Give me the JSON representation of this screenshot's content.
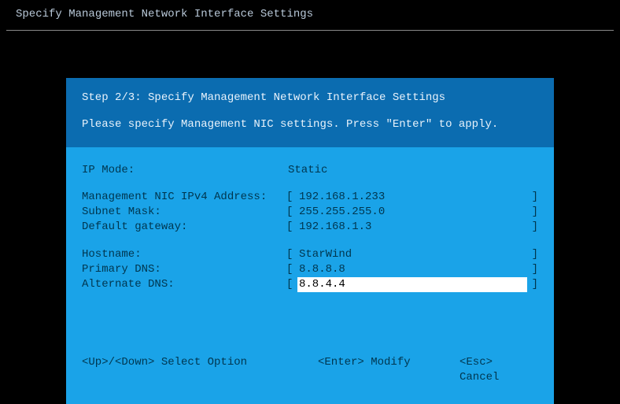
{
  "page_title": "Specify Management Network Interface Settings",
  "header": {
    "step_line": "Step 2/3: Specify Management Network Interface Settings",
    "instruction": "Please specify Management NIC settings. Press \"Enter\" to apply."
  },
  "fields": {
    "ip_mode": {
      "label": "IP Mode:",
      "value": "Static"
    },
    "ipv4": {
      "label": "Management NIC IPv4 Address:",
      "value": "192.168.1.233"
    },
    "subnet": {
      "label": "Subnet Mask:",
      "value": "255.255.255.0"
    },
    "gateway": {
      "label": "Default gateway:",
      "value": "192.168.1.3"
    },
    "hostname": {
      "label": "Hostname:",
      "value": "StarWind"
    },
    "dns1": {
      "label": "Primary DNS:",
      "value": "8.8.8.8"
    },
    "dns2": {
      "label": "Alternate DNS:",
      "value": "8.8.4.4"
    }
  },
  "footer": {
    "up_down": "<Up>/<Down> Select Option",
    "enter": "<Enter> Modify",
    "esc": "<Esc> Cancel"
  }
}
